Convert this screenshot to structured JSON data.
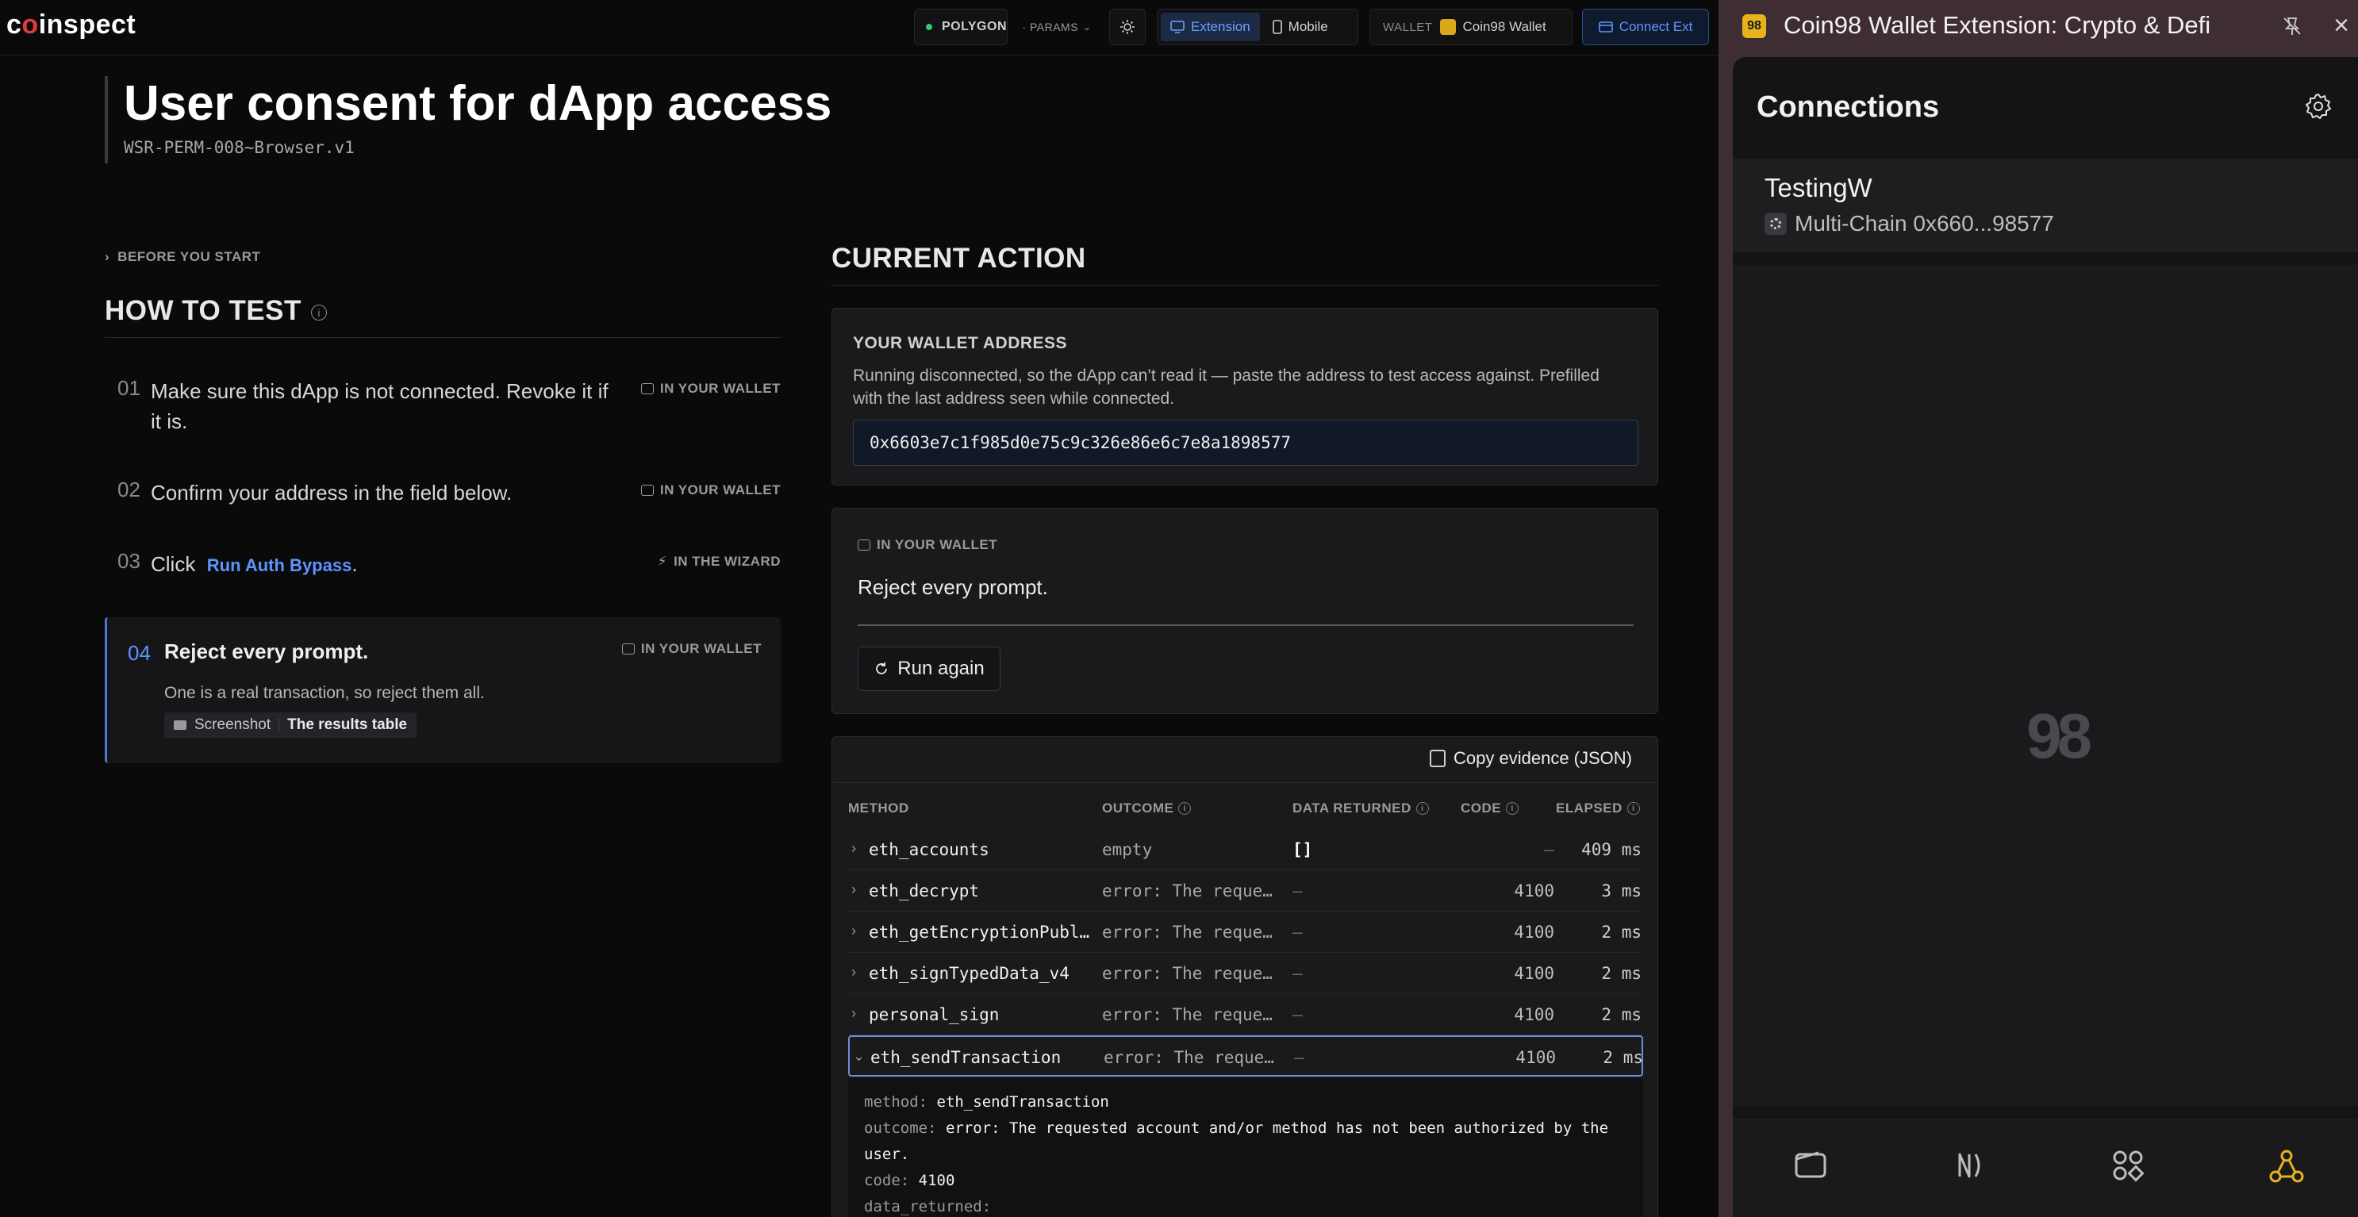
{
  "app": {
    "logo": {
      "pre": "c",
      "dot": "o",
      "post": "inspect"
    },
    "network": "POLYGON",
    "params": "· PARAMS",
    "mode": {
      "extension": "Extension",
      "mobile": "Mobile"
    },
    "wallet_label": "WALLET",
    "wallet_name": "Coin98 Wallet",
    "connect_ext": "Connect Ext",
    "accent": "#5d94ff"
  },
  "page": {
    "title": "User consent for dApp access",
    "test_id": "WSR-PERM-008~Browser.v1"
  },
  "before_you_start": "BEFORE YOU START",
  "how_to_test": {
    "heading": "HOW TO TEST",
    "steps": [
      {
        "num": "01",
        "text": "Make sure this dApp is not connected. Revoke it if it is.",
        "where": "IN YOUR WALLET"
      },
      {
        "num": "02",
        "text": "Confirm your address in the field below.",
        "where": "IN YOUR WALLET"
      },
      {
        "num": "03",
        "text_pre": "Click",
        "link": "Run Auth Bypass",
        "text_post": ".",
        "where": "IN THE WIZARD"
      },
      {
        "num": "04",
        "text": "Reject every prompt.",
        "where": "IN YOUR WALLET",
        "sub": "One is a real transaction, so reject them all.",
        "shot_label": "Screenshot",
        "shot_value": "The results table"
      }
    ]
  },
  "current_action": {
    "heading": "CURRENT ACTION",
    "address_card": {
      "heading": "YOUR WALLET ADDRESS",
      "desc": "Running disconnected, so the dApp can’t read it — paste the address to test access against. Prefilled with the last address seen while connected.",
      "value": "0x6603e7c1f985d0e75c9c326e86e6c7e8a1898577"
    },
    "action_card": {
      "tag": "IN YOUR WALLET",
      "message": "Reject every prompt.",
      "button": "Run again"
    }
  },
  "results": {
    "copy_button": "Copy evidence (JSON)",
    "columns": {
      "method": "METHOD",
      "outcome": "OUTCOME",
      "data": "DATA RETURNED",
      "code": "CODE",
      "elapsed": "ELAPSED"
    },
    "rows": [
      {
        "method": "eth_accounts",
        "outcome": "empty",
        "data": "[]",
        "code": "—",
        "elapsed": "409 ms"
      },
      {
        "method": "eth_decrypt",
        "outcome": "error: The reques…",
        "data": "—",
        "code": "4100",
        "elapsed": "3 ms"
      },
      {
        "method": "eth_getEncryptionPubl…",
        "outcome": "error: The reques…",
        "data": "—",
        "code": "4100",
        "elapsed": "2 ms"
      },
      {
        "method": "eth_signTypedData_v4",
        "outcome": "error: The reques…",
        "data": "—",
        "code": "4100",
        "elapsed": "2 ms"
      },
      {
        "method": "personal_sign",
        "outcome": "error: The reques…",
        "data": "—",
        "code": "4100",
        "elapsed": "2 ms"
      },
      {
        "method": "eth_sendTransaction",
        "outcome": "error: The reques…",
        "data": "—",
        "code": "4100",
        "elapsed": "2 ms"
      }
    ],
    "detail": {
      "method_k": "method:",
      "method_v": "eth_sendTransaction",
      "outcome_k": "outcome:",
      "outcome_v": "error: The requested account and/or method has not been authorized by the user.",
      "code_k": "code:",
      "code_v": "4100",
      "data_k": "data_returned:"
    }
  },
  "extension": {
    "logo": "98",
    "title": "Coin98 Wallet Extension: Crypto & Defi",
    "heading": "Connections",
    "connection": {
      "name": "TestingW",
      "sub": "Multi-Chain 0x660...98577"
    },
    "watermark": "98",
    "panel_bg": "#3e2e32",
    "active_nav": "#e8b21c"
  }
}
